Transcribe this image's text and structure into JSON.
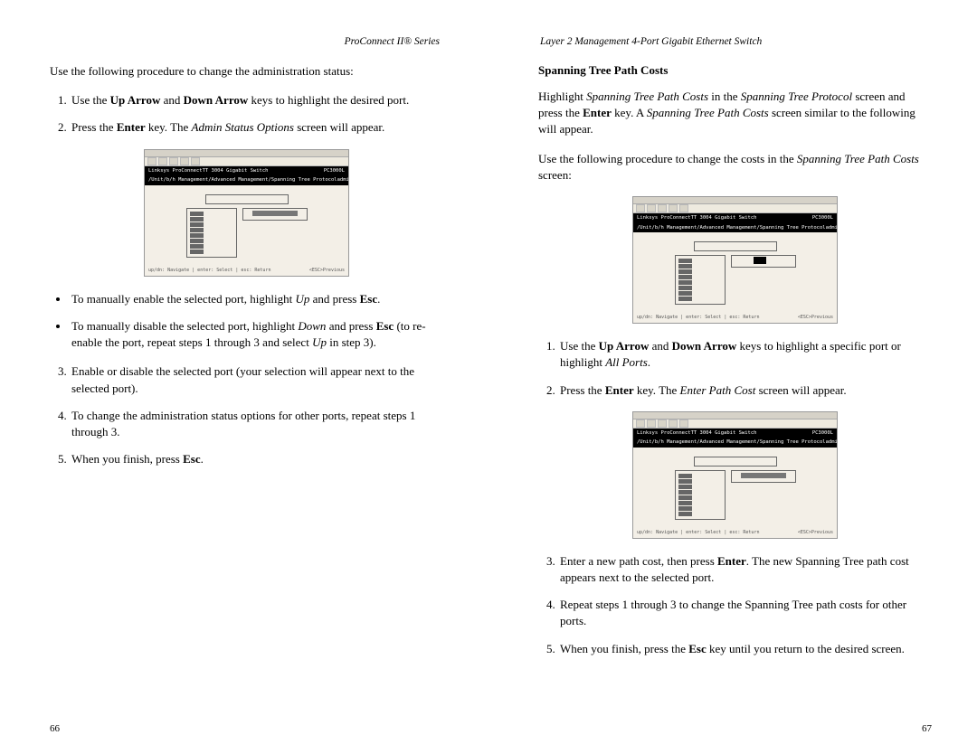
{
  "left": {
    "header": "ProConnect II® Series",
    "intro": "Use the following procedure to change the administration status:",
    "steps1": [
      "Use the <b>Up Arrow</b> and <b>Down Arrow</b> keys to highlight the desired port.",
      "Press the <b>Enter</b> key. The <i>Admin Status Options</i> screen will appear."
    ],
    "bullets": [
      "To manually enable the selected port, highlight <i>Up</i> and press <b>Esc</b>.",
      "To manually disable the selected port, highlight <i>Down</i> and press <b>Esc</b> (to re-enable the port, repeat steps 1 through 3 and select <i>Up</i> in step 3)."
    ],
    "steps2": [
      "Enable or disable the selected port (your selection will appear next to the selected port).",
      "To change the administration status options for other ports, repeat steps 1 through 3.",
      "When you finish, press <b>Esc</b>."
    ],
    "pagenum": "66"
  },
  "right": {
    "header": "Layer 2 Management 4-Port Gigabit Ethernet Switch",
    "title": "Spanning Tree Path Costs",
    "p1": "Highlight <i>Spanning Tree Path Costs</i> in the <i>Spanning Tree Protocol</i> screen and press the <b>Enter</b> key. A <i>Spanning Tree Path Costs</i> screen similar to the following will appear.",
    "p2": "Use the following procedure to change the costs in the <i>Spanning Tree Path Costs</i> screen:",
    "stepsA": [
      "Use the <b>Up Arrow</b> and <b>Down Arrow</b> keys to highlight a specific port or highlight <i>All Ports</i>.",
      "Press the <b>Enter</b> key. The <i>Enter Path Cost</i> screen will appear."
    ],
    "stepsB": [
      "Enter a new path cost, then press <b>Enter</b>. The new Spanning Tree path cost appears next to the selected port.",
      "Repeat steps 1 through 3 to change the Spanning Tree path costs for other ports.",
      "When you finish, press the <b>Esc</b> key until you return to the desired screen."
    ],
    "pagenum": "67"
  },
  "term": {
    "title_l": "Linksys ProConnectTT 3004 Gigabit Switch",
    "title_r": "PC3000L",
    "sub_l": "/Unit/b/h Management/Advanced Management/Spanning Tree Protocol",
    "sub_r": "admin",
    "foot_l": "up/dn: Navigate | enter: Select | esc: Return",
    "foot_r": "<ESC>Previous"
  }
}
